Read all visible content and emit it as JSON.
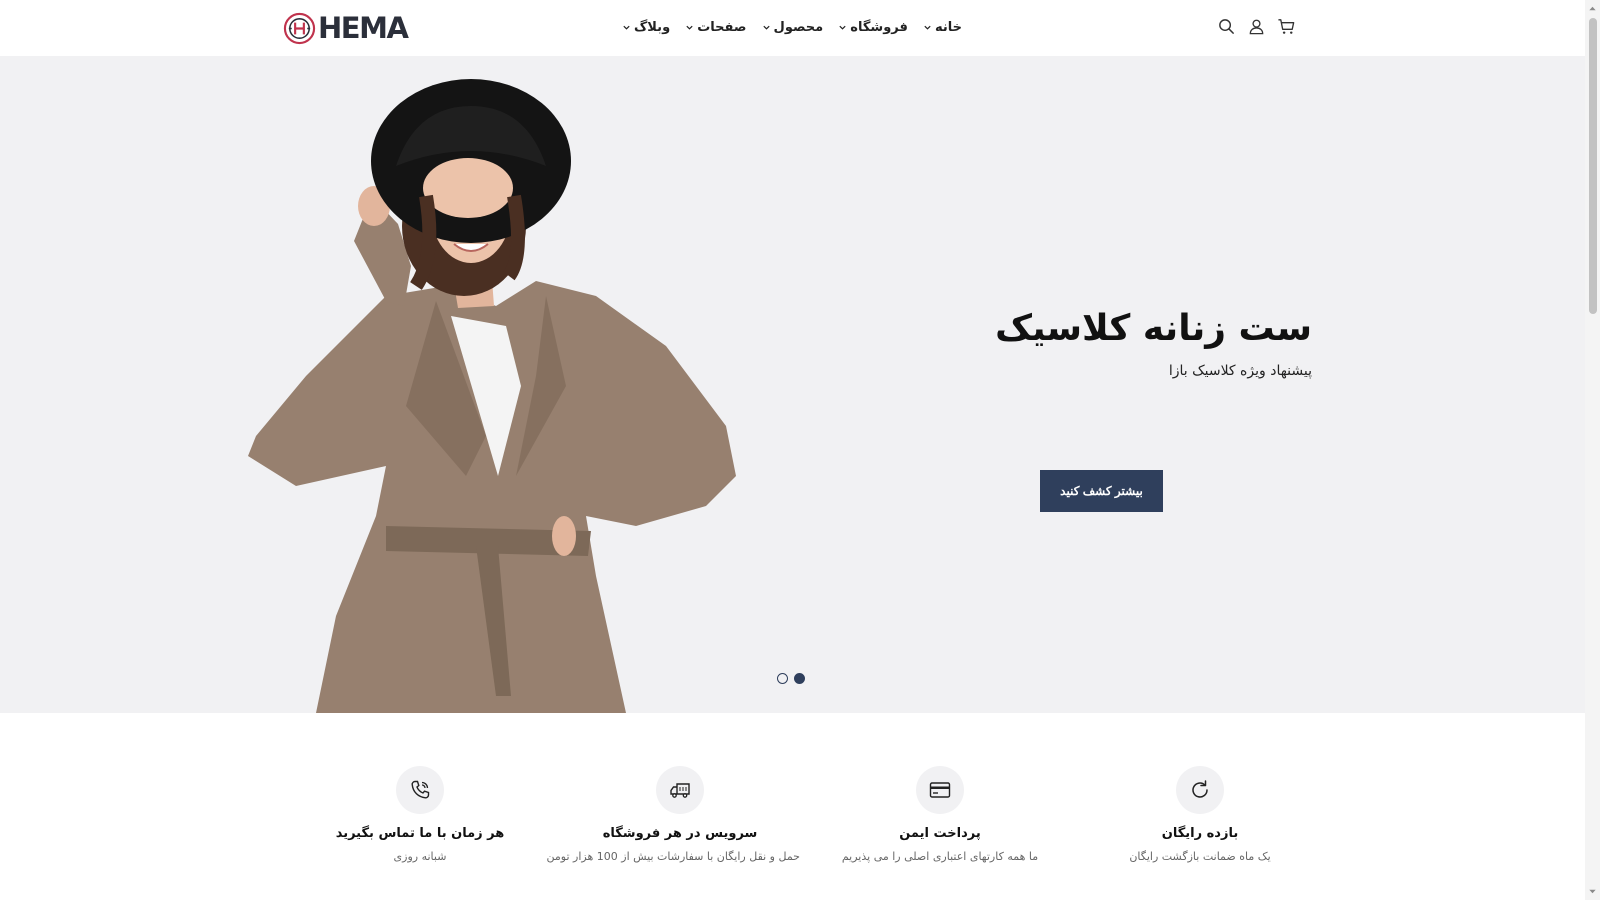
{
  "brand": {
    "logo_text": "HEMA",
    "accent": "#c0334d",
    "primary": "#2f3f5c"
  },
  "nav": [
    {
      "label": "خانه",
      "icon": "chevron-down-icon"
    },
    {
      "label": "فروشگاه",
      "icon": "chevron-down-icon"
    },
    {
      "label": "محصول",
      "icon": "chevron-down-icon"
    },
    {
      "label": "صفحات",
      "icon": "chevron-down-icon"
    },
    {
      "label": "وبلاگ",
      "icon": "chevron-down-icon"
    }
  ],
  "header_icons": [
    "search-icon",
    "user-icon",
    "cart-icon"
  ],
  "hero": {
    "title": "ست زنانه کلاسیک",
    "subtitle": "پیشنهاد ویژه کلاسیک بازا",
    "button_label": "بیشتر کشف کنید",
    "slides": {
      "count": 2,
      "active_index": 1
    }
  },
  "features": [
    {
      "icon": "phone-icon",
      "title": "هر زمان با ما تماس بگیرید",
      "desc": "شبانه روزی"
    },
    {
      "icon": "delivery-truck-icon",
      "title": "سرویس در هر فروشگاه",
      "desc": "حمل و نقل رایگان با سفارشات بیش از 100 هزار تومن"
    },
    {
      "icon": "credit-card-icon",
      "title": "پرداخت ایمن",
      "desc": "ما همه کارتهای اعتباری اصلی را می پذیریم"
    },
    {
      "icon": "refresh-icon",
      "title": "بازده رایگان",
      "desc": "یک ماه ضمانت بازگشت رایگان"
    }
  ]
}
